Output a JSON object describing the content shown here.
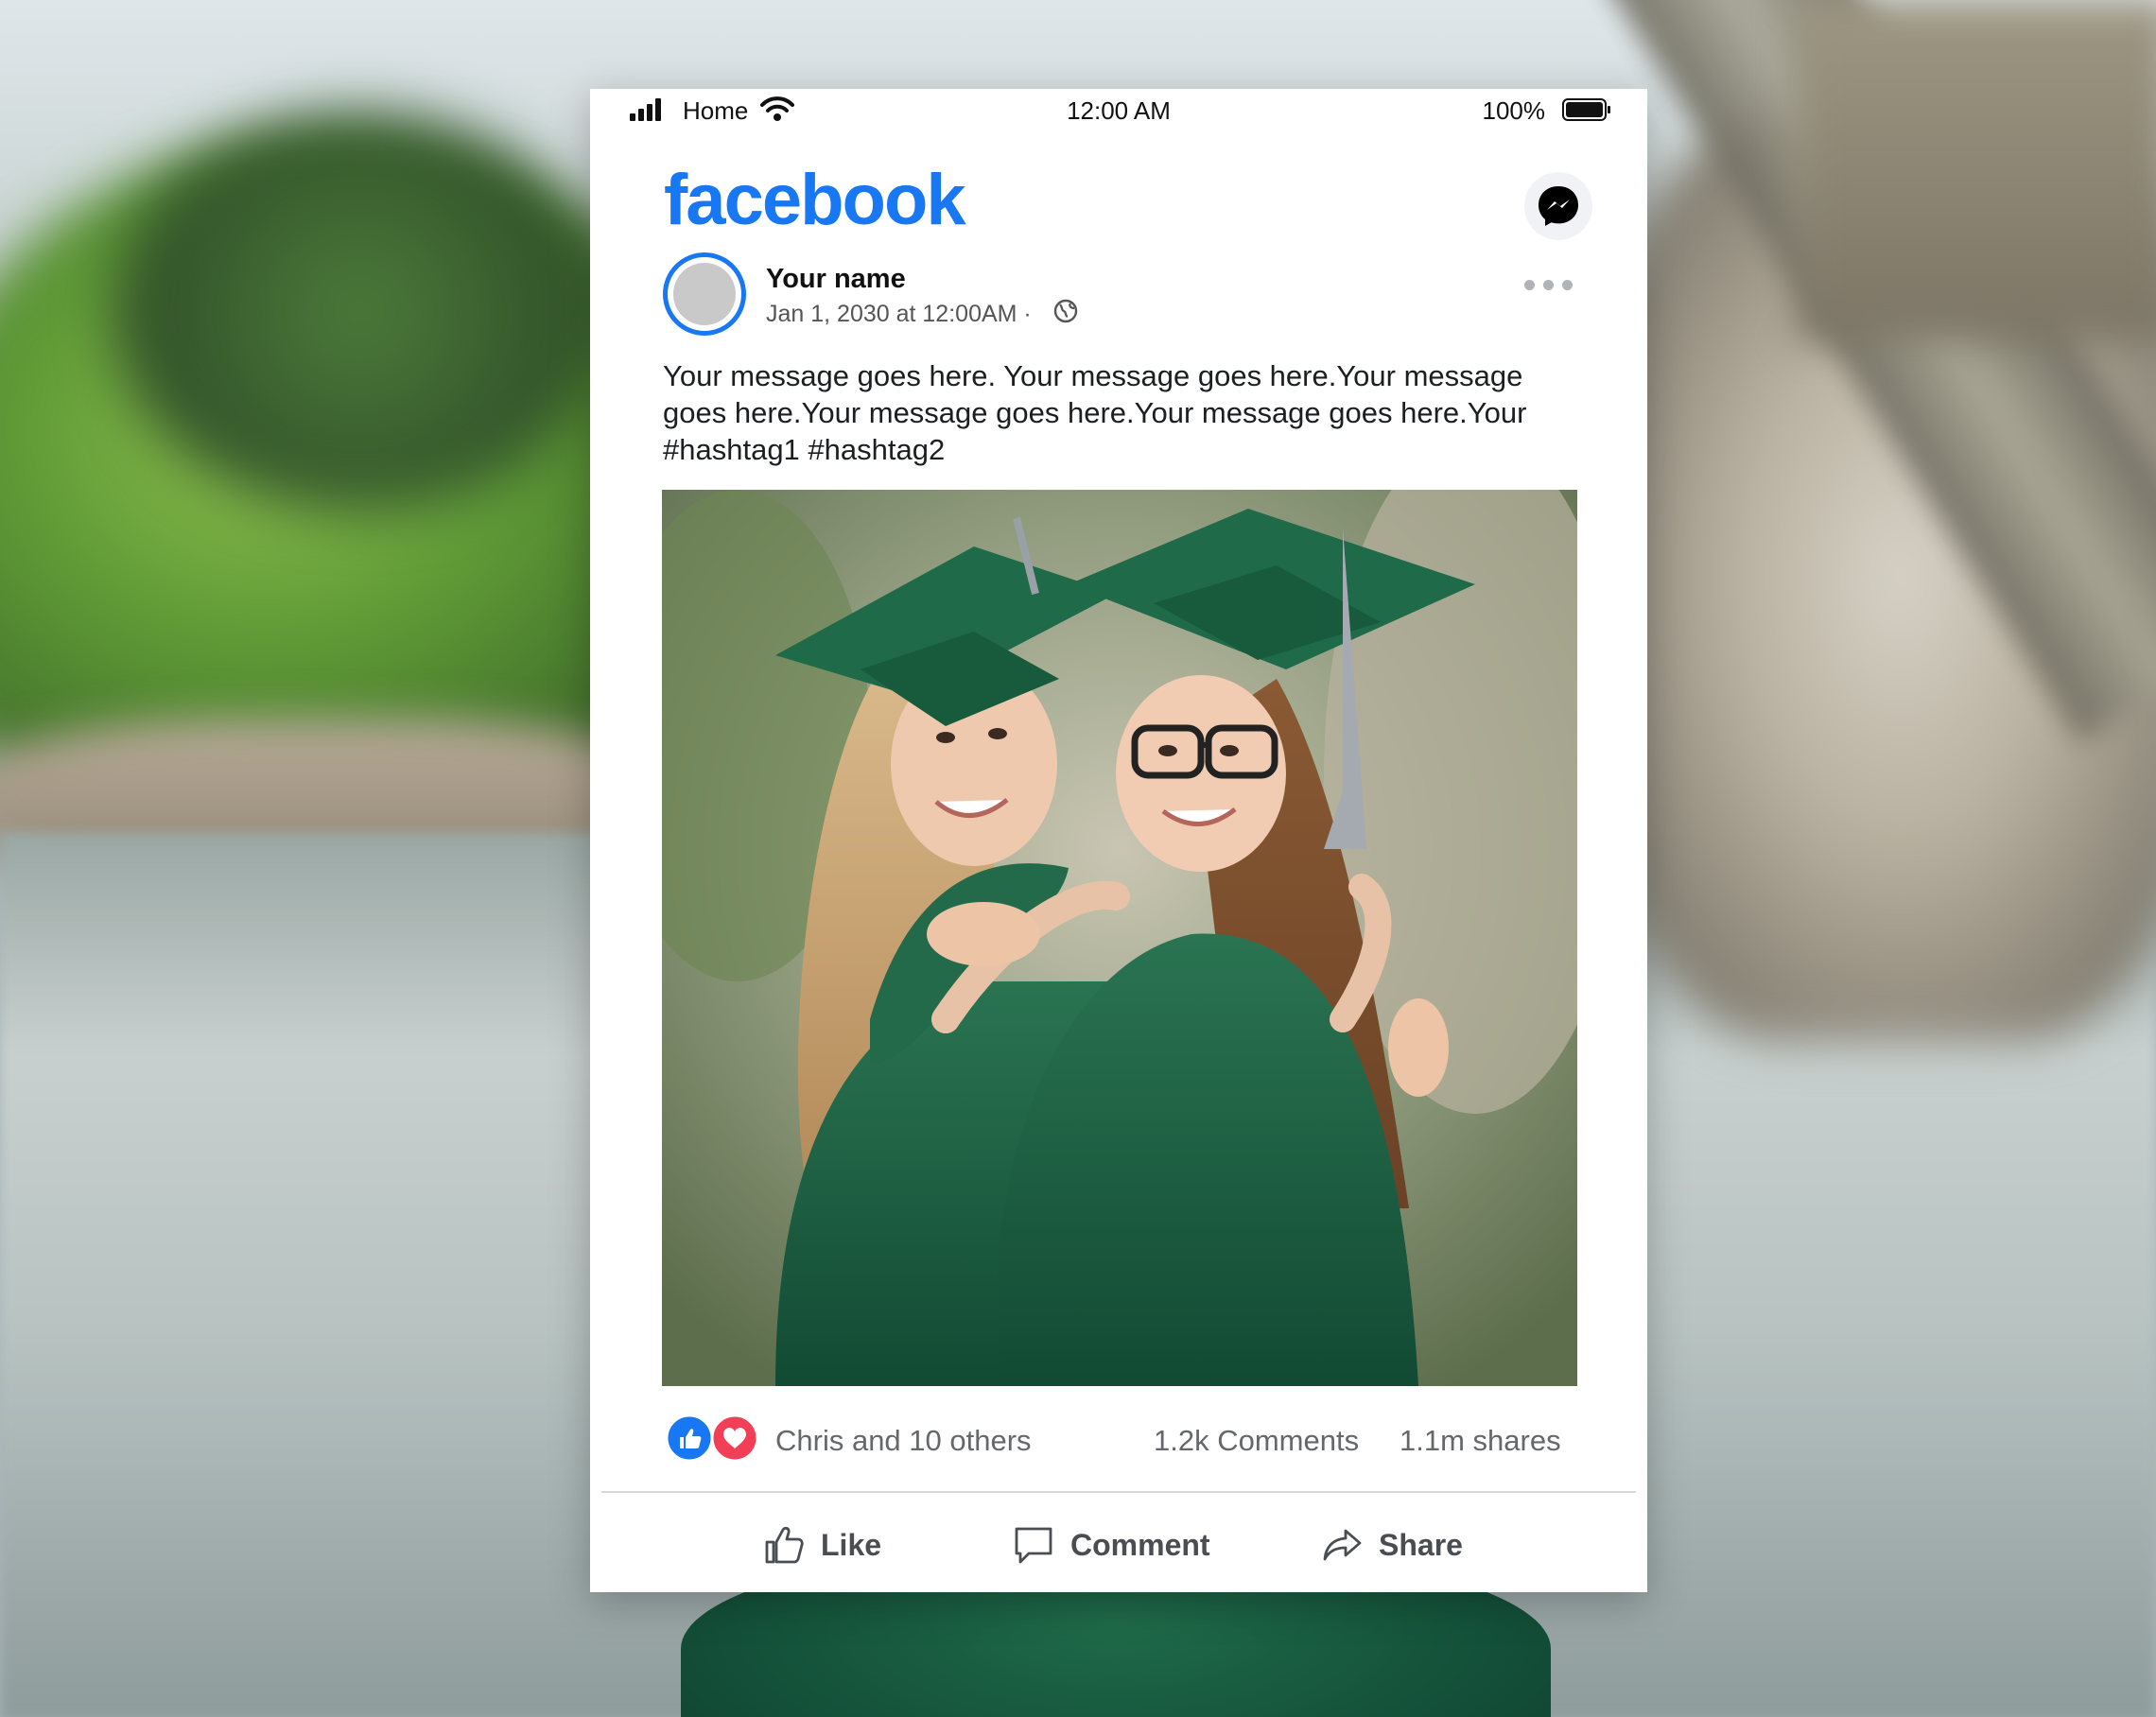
{
  "status_bar": {
    "carrier": "Home",
    "time": "12:00 AM",
    "battery": "100%",
    "icons": [
      "signal-icon",
      "wifi-icon",
      "battery-icon"
    ]
  },
  "header": {
    "logo": "facebook",
    "messenger_icon": "messenger-icon"
  },
  "post": {
    "author": "Your name",
    "timestamp": "Jan 1, 2030 at 12:00AM ·",
    "privacy_icon": "globe-icon",
    "menu_icon": "more-horizontal-icon",
    "message": "Your message goes here. Your message goes here.Your message goes here.Your message goes here.Your message goes here.Your #hashtag1 #hashtag2",
    "photo": "two-graduates-hugging-photo",
    "reactions": {
      "icons": [
        "like-reaction-icon",
        "love-reaction-icon"
      ],
      "text": "Chris and 10 others"
    },
    "comments": "1.2k Comments",
    "shares": "1.1m shares"
  },
  "actions": [
    {
      "label": "Like",
      "icon": "thumbs-up-icon"
    },
    {
      "label": "Comment",
      "icon": "comment-icon"
    },
    {
      "label": "Share",
      "icon": "share-icon"
    }
  ],
  "colors": {
    "brand": "#1877f2",
    "love": "#f33e58",
    "muted_text": "#65676b",
    "graduation_gown": "#1b5e43"
  }
}
